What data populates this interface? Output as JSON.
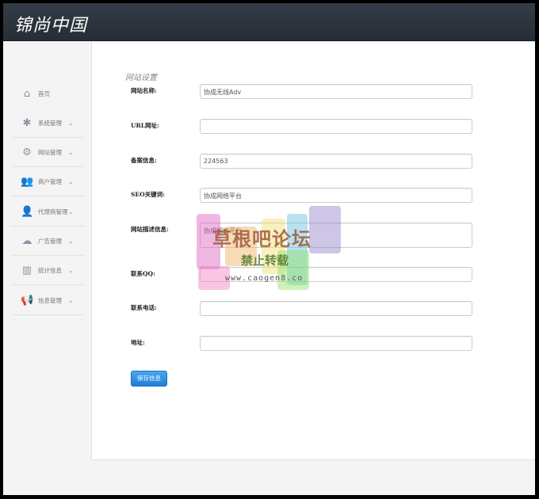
{
  "header": {
    "logo": "锦尚中国"
  },
  "sidebar": {
    "items": [
      {
        "label": "首页",
        "icon": "home-icon",
        "chevron": false
      },
      {
        "label": "系统管理",
        "icon": "asterisk-icon",
        "chevron": true
      },
      {
        "label": "网站管理",
        "icon": "gears-icon",
        "chevron": true
      },
      {
        "label": "商户管理",
        "icon": "users-icon",
        "chevron": true
      },
      {
        "label": "代理商管理",
        "icon": "user-agent-icon",
        "chevron": true
      },
      {
        "label": "广告管理",
        "icon": "cloud-icon",
        "chevron": true
      },
      {
        "label": "统计信息",
        "icon": "bar-chart-icon",
        "chevron": true
      },
      {
        "label": "信息管理",
        "icon": "megaphone-icon",
        "chevron": true
      }
    ]
  },
  "main": {
    "title": "网站设置",
    "fields": [
      {
        "label": "网站名称:",
        "value": ""
      },
      {
        "label": "URL网址:",
        "value": ""
      },
      {
        "label": "备案信息:",
        "value": "224563"
      },
      {
        "label": "SEO关键词:",
        "value": "协成网络平台"
      },
      {
        "label": "网站描述信息:",
        "value": "协成网络平台"
      },
      {
        "label": "联系QQ:",
        "value": ""
      },
      {
        "label": "联系电话:",
        "value": ""
      },
      {
        "label": "地址:",
        "value": ""
      }
    ],
    "site_name_value": "协成无线Adv",
    "save_label": "保存信息"
  },
  "watermark": {
    "line1": "草根吧论坛",
    "line2": "禁止转载",
    "line3": "www.caogen8.co"
  }
}
